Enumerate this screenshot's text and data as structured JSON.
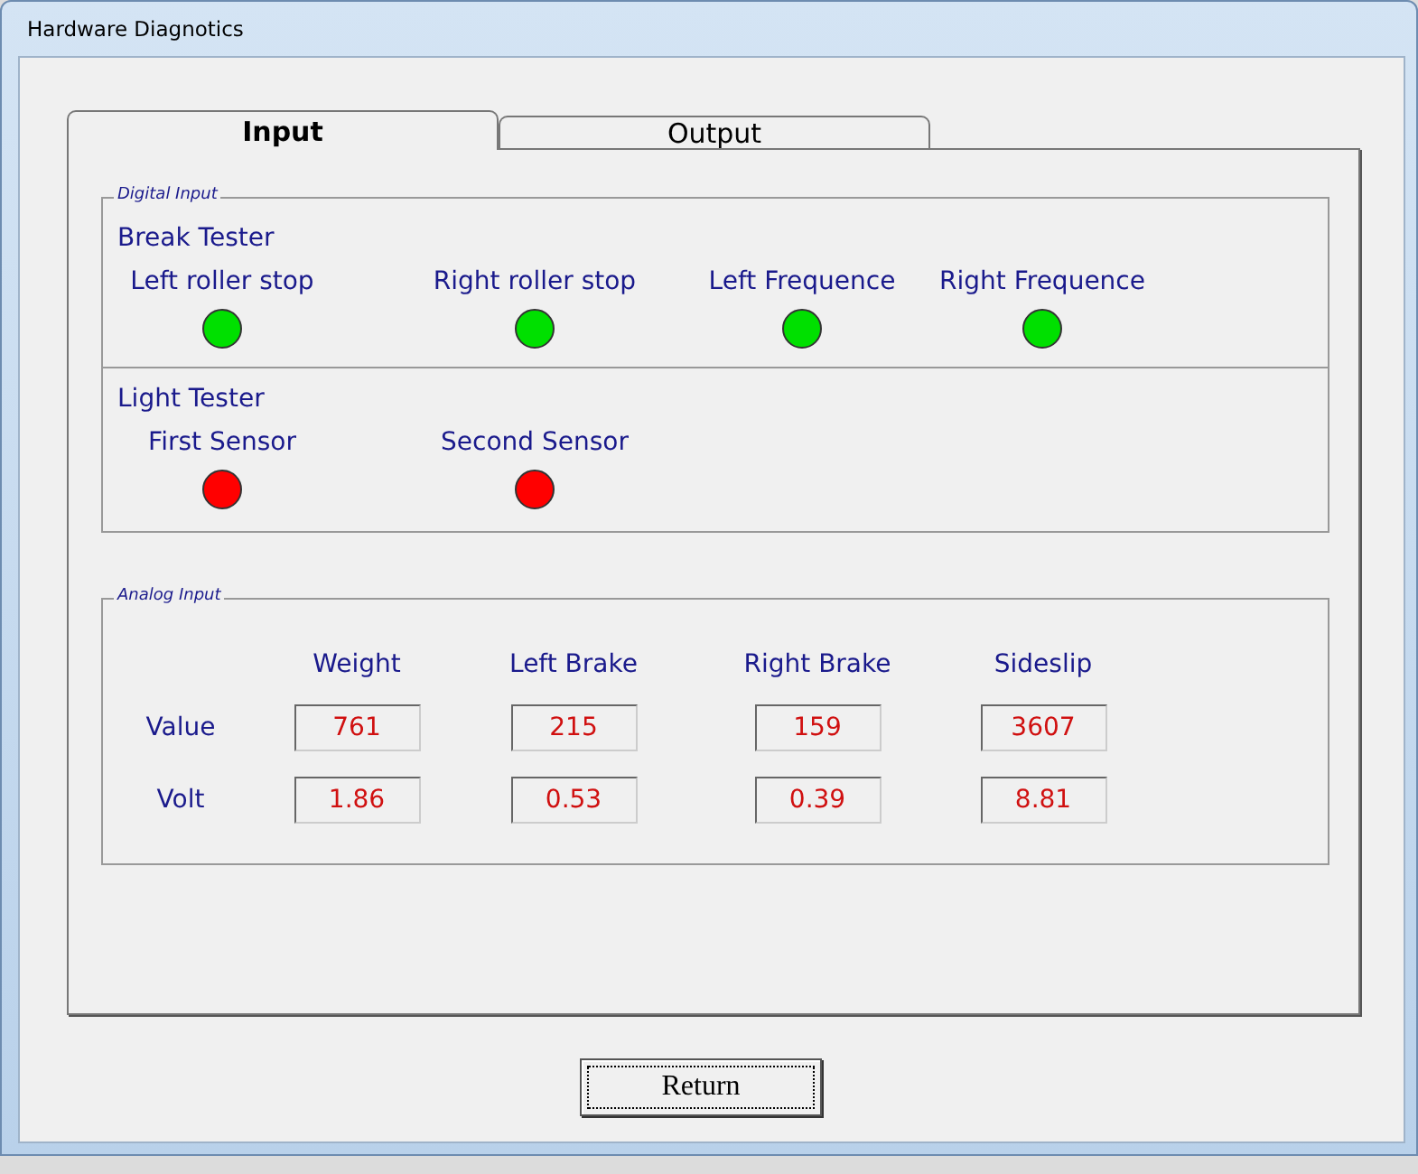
{
  "window": {
    "title": "Hardware Diagnotics"
  },
  "tabs": [
    {
      "label": "Input",
      "selected": true
    },
    {
      "label": "Output",
      "selected": false
    }
  ],
  "digital_input": {
    "title": "Digital Input",
    "sections": [
      {
        "title": "Break Tester",
        "indicators": [
          {
            "label": "Left roller stop",
            "color": "#00e000"
          },
          {
            "label": "Right roller stop",
            "color": "#00e000"
          },
          {
            "label": "Left Frequence",
            "color": "#00e000"
          },
          {
            "label": "Right Frequence",
            "color": "#00e000"
          }
        ]
      },
      {
        "title": "Light Tester",
        "indicators": [
          {
            "label": "First Sensor",
            "color": "#ff0000"
          },
          {
            "label": "Second Sensor",
            "color": "#ff0000"
          }
        ]
      }
    ]
  },
  "analog_input": {
    "title": "Analog Input",
    "columns": [
      "Weight",
      "Left Brake",
      "Right Brake",
      "Sideslip"
    ],
    "rows": [
      {
        "label": "Value",
        "values": [
          "761",
          "215",
          "159",
          "3607"
        ]
      },
      {
        "label": "Volt",
        "values": [
          "1.86",
          "0.53",
          "0.39",
          "8.81"
        ]
      }
    ]
  },
  "buttons": [
    "Return"
  ]
}
